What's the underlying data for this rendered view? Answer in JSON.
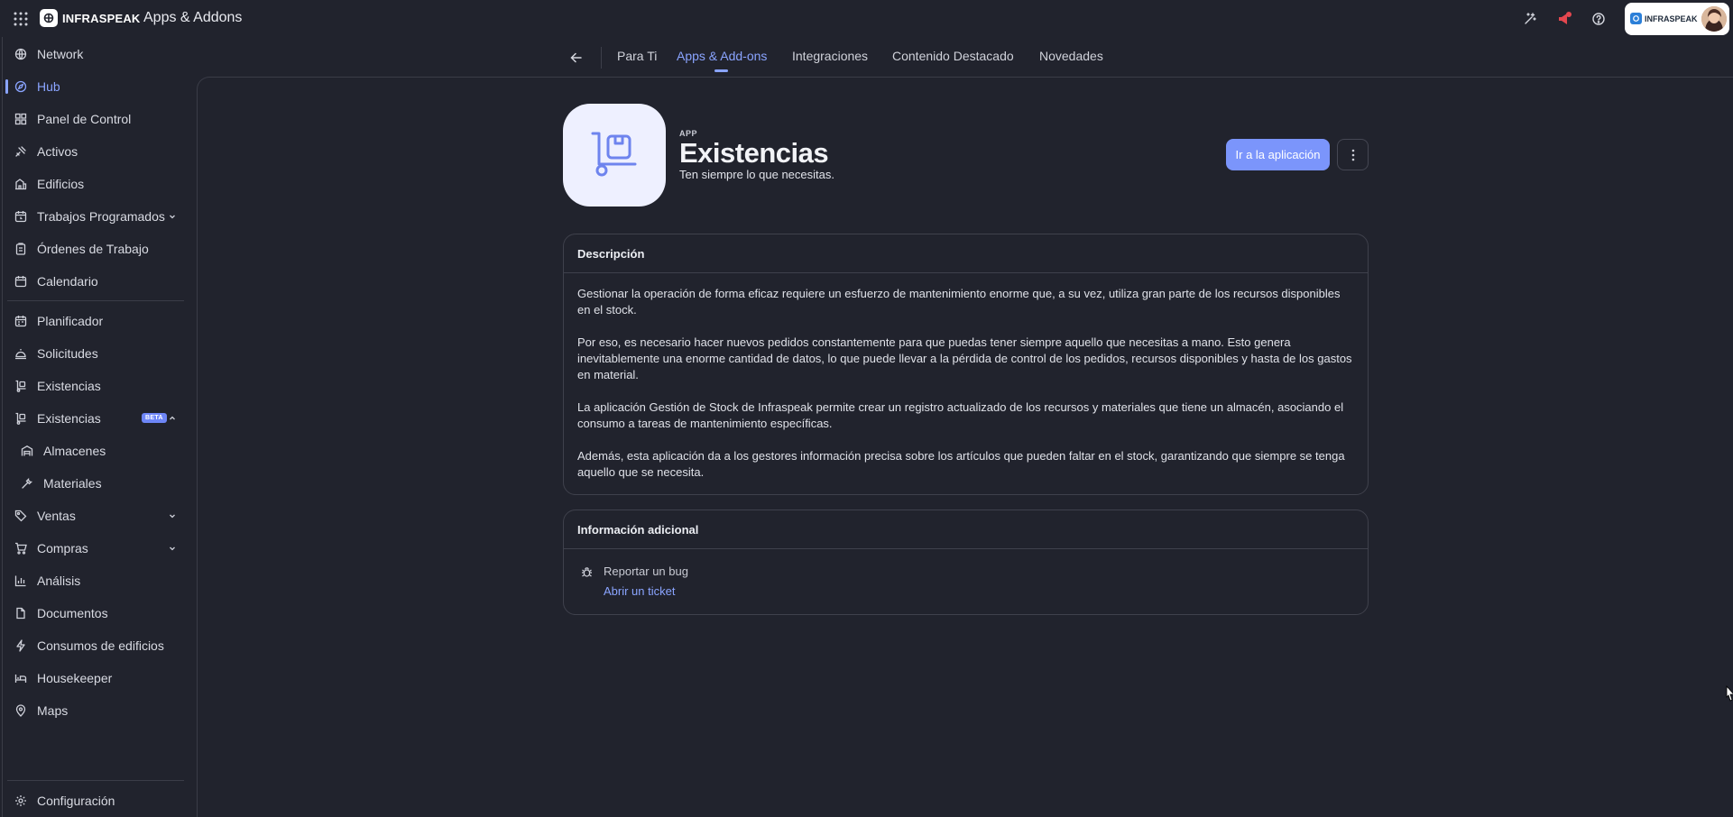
{
  "header": {
    "logo_text": "INFRASPEAK",
    "app_title": "Apps & Addons",
    "company_text": "INFRASPEAK"
  },
  "sidebar": {
    "items": [
      {
        "label": "Network",
        "icon": "globe-icon"
      },
      {
        "label": "Hub",
        "icon": "compass-icon",
        "active": true
      },
      {
        "label": "Panel de Control",
        "icon": "dashboard-icon"
      },
      {
        "label": "Activos",
        "icon": "assets-icon"
      },
      {
        "label": "Edificios",
        "icon": "building-icon"
      },
      {
        "label": "Trabajos Programados",
        "icon": "calendar-clock-icon",
        "expandable": true
      },
      {
        "label": "Órdenes de Trabajo",
        "icon": "clipboard-icon"
      },
      {
        "label": "Calendario",
        "icon": "calendar-icon"
      },
      {
        "label": "Planificador",
        "icon": "planner-icon"
      },
      {
        "label": "Solicitudes",
        "icon": "bell-service-icon"
      },
      {
        "label": "Existencias",
        "icon": "trolley-icon"
      },
      {
        "label": "Existencias",
        "icon": "trolley-icon",
        "badge": "BETA",
        "expanded": true
      },
      {
        "label": "Almacenes",
        "icon": "warehouse-icon",
        "sub": true
      },
      {
        "label": "Materiales",
        "icon": "wrench-icon",
        "sub": true
      },
      {
        "label": "Ventas",
        "icon": "tag-icon",
        "expandable": true
      },
      {
        "label": "Compras",
        "icon": "cart-icon",
        "expandable": true
      },
      {
        "label": "Análisis",
        "icon": "bar-chart-icon"
      },
      {
        "label": "Documentos",
        "icon": "document-icon"
      },
      {
        "label": "Consumos de edificios",
        "icon": "lightning-icon"
      },
      {
        "label": "Housekeeper",
        "icon": "bed-icon"
      },
      {
        "label": "Maps",
        "icon": "map-pin-icon"
      }
    ],
    "settings_label": "Configuración"
  },
  "tabs": [
    {
      "label": "Para Ti"
    },
    {
      "label": "Apps & Add-ons",
      "active": true
    },
    {
      "label": "Integraciones"
    },
    {
      "label": "Contenido Destacado"
    },
    {
      "label": "Novedades"
    }
  ],
  "app": {
    "kicker": "APP",
    "name": "Existencias",
    "tagline": "Ten siempre lo que necesitas.",
    "go_button": "Ir a la aplicación",
    "icon": "trolley-icon"
  },
  "description": {
    "title": "Descripción",
    "paragraphs": [
      "Gestionar la operación de forma eficaz requiere un esfuerzo de mantenimiento enorme que, a su vez, utiliza gran parte de los recursos disponibles en el stock.",
      "Por eso, es necesario hacer nuevos pedidos constantemente para que puedas tener siempre aquello que necesitas a mano. Esto genera inevitablemente una enorme cantidad de datos, lo que puede llevar a la pérdida de control de los pedidos, recursos disponibles y hasta de los gastos en material.",
      "La aplicación Gestión de Stock de Infraspeak permite crear un registro actualizado de los recursos y materiales que tiene un almacén, asociando el consumo a tareas de mantenimiento específicas.",
      "Además, esta aplicación da a los gestores información precisa sobre los artículos que pueden faltar en el stock, garantizando que siempre se tenga aquello que se necesita."
    ]
  },
  "additional": {
    "title": "Información adicional",
    "bug_label": "Reportar un bug",
    "ticket_link": "Abrir un ticket"
  },
  "colors": {
    "background": "#21232d",
    "accent": "#8aa4ff",
    "button": "#7b95fb"
  }
}
